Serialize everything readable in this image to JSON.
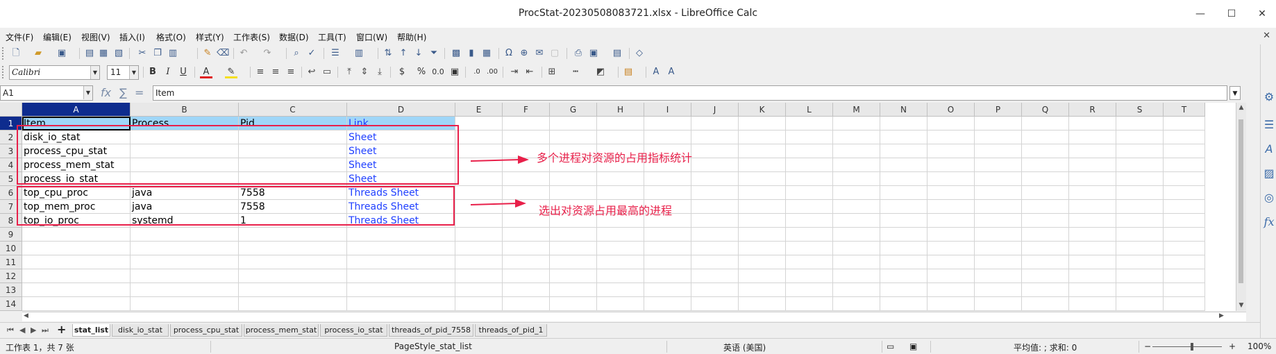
{
  "window": {
    "title": "ProcStat-20230508083721.xlsx - LibreOffice Calc",
    "minimize": "—",
    "maximize": "☐",
    "close": "✕"
  },
  "menu": [
    "文件(F)",
    "编辑(E)",
    "视图(V)",
    "插入(I)",
    "格式(O)",
    "样式(Y)",
    "工作表(S)",
    "数据(D)",
    "工具(T)",
    "窗口(W)",
    "帮助(H)"
  ],
  "formatting": {
    "font_name": "Calibri",
    "font_size": "11"
  },
  "formula_bar": {
    "name_box": "A1",
    "fx": "fx",
    "sigma": "∑",
    "equals": "=",
    "content": "Item"
  },
  "columns": [
    "A",
    "B",
    "C",
    "D",
    "E",
    "F",
    "G",
    "H",
    "I",
    "J",
    "K",
    "L",
    "M",
    "N",
    "O",
    "P",
    "Q",
    "R",
    "S",
    "T"
  ],
  "rows": [
    "1",
    "2",
    "3",
    "4",
    "5",
    "6",
    "7",
    "8",
    "9",
    "10",
    "11",
    "12",
    "13",
    "14"
  ],
  "cells": [
    [
      "Item",
      "Process",
      "Pid",
      "Link"
    ],
    [
      "disk_io_stat",
      "",
      "",
      "Sheet"
    ],
    [
      "process_cpu_stat",
      "",
      "",
      "Sheet"
    ],
    [
      "process_mem_stat",
      "",
      "",
      "Sheet"
    ],
    [
      "process_io_stat",
      "",
      "",
      "Sheet"
    ],
    [
      "top_cpu_proc",
      "java",
      "7558",
      "Threads Sheet"
    ],
    [
      "top_mem_proc",
      "java",
      "7558",
      "Threads Sheet"
    ],
    [
      "top_io_proc",
      "systemd",
      "1",
      "Threads Sheet"
    ]
  ],
  "annotations": {
    "note1": "多个进程对资源的占用指标统计",
    "note2": "选出对资源占用最高的进程",
    "color": "#e8204a"
  },
  "colors": {
    "header_fill": "#9fd6f8",
    "link": "#1f3fff",
    "selected_header": "#0e2c8e"
  },
  "sheet_tabs": [
    "stat_list",
    "disk_io_stat",
    "process_cpu_stat",
    "process_mem_stat",
    "process_io_stat",
    "threads_of_pid_7558",
    "threads_of_pid_1"
  ],
  "active_tab": "stat_list",
  "status": {
    "sheet_info": "工作表 1，共 7 张",
    "page_style": "PageStyle_stat_list",
    "language": "英语 (美国)",
    "summary": "平均值: ; 求和: 0",
    "zoom": "100%",
    "zoom_minus": "−",
    "zoom_plus": "+"
  }
}
